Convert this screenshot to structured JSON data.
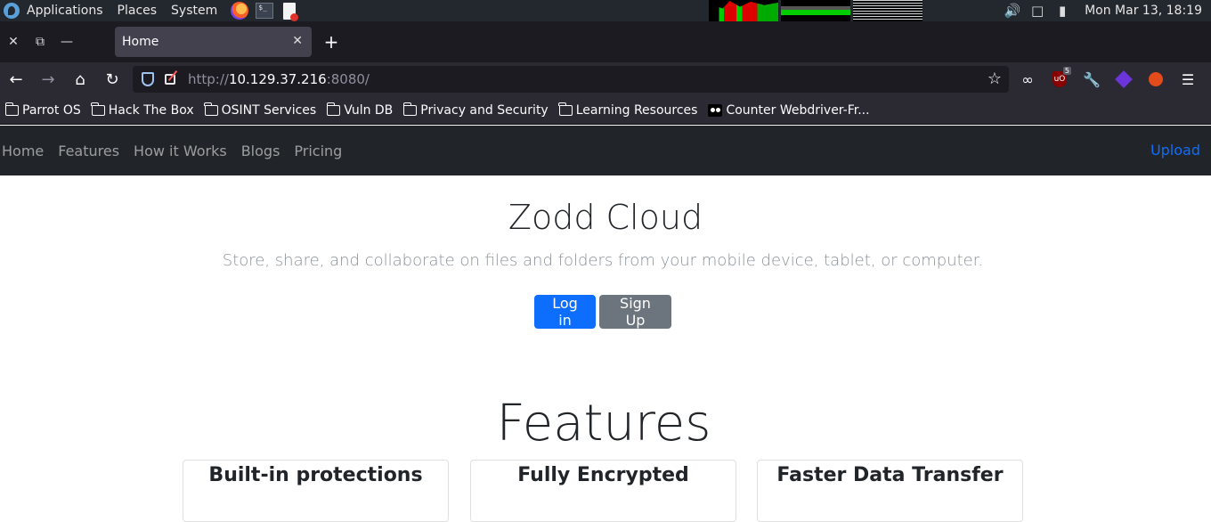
{
  "os_panel": {
    "menus": [
      "Applications",
      "Places",
      "System"
    ],
    "clock": "Mon Mar 13, 18:19"
  },
  "browser": {
    "tab_title": "Home",
    "url_scheme": "http://",
    "url_host": "10.129.37.216",
    "url_port": ":8080/",
    "ublock_badge": "5",
    "bookmarks": [
      "Parrot OS",
      "Hack The Box",
      "OSINT Services",
      "Vuln DB",
      "Privacy and Security",
      "Learning Resources",
      "Counter Webdriver-Fr..."
    ]
  },
  "site": {
    "nav": [
      "Home",
      "Features",
      "How it Works",
      "Blogs",
      "Pricing"
    ],
    "upload": "Upload",
    "title": "Zodd Cloud",
    "subtitle": "Store, share, and collaborate on files and folders from your mobile device, tablet, or computer.",
    "login": "Log in",
    "signup": "Sign Up",
    "features_heading": "Features",
    "cards": [
      "Built-in protections",
      "Fully Encrypted",
      "Faster Data Transfer"
    ]
  },
  "colors": {
    "primary": "#0d6efd",
    "secondary": "#6c757d",
    "navbar_dark": "#212529"
  }
}
